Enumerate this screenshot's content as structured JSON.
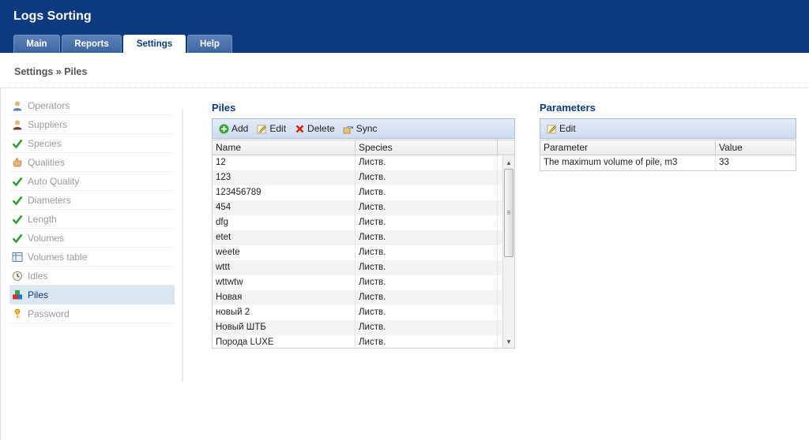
{
  "app": {
    "title": "Logs Sorting"
  },
  "tabs": [
    {
      "label": "Main"
    },
    {
      "label": "Reports"
    },
    {
      "label": "Settings",
      "active": true
    },
    {
      "label": "Help"
    }
  ],
  "breadcrumb": "Settings » Piles",
  "sidebar": {
    "items": [
      {
        "label": "Operators",
        "icon": "user-icon"
      },
      {
        "label": "Suppliers",
        "icon": "user-dark-icon"
      },
      {
        "label": "Species",
        "icon": "check-icon"
      },
      {
        "label": "Qualities",
        "icon": "hand-icon"
      },
      {
        "label": "Auto Quality",
        "icon": "check-icon"
      },
      {
        "label": "Diameters",
        "icon": "check-icon"
      },
      {
        "label": "Length",
        "icon": "check-icon"
      },
      {
        "label": "Volumes",
        "icon": "check-icon"
      },
      {
        "label": "Volumes table",
        "icon": "table-icon"
      },
      {
        "label": "Idles",
        "icon": "clock-icon"
      },
      {
        "label": "Piles",
        "icon": "boxes-icon",
        "active": true
      },
      {
        "label": "Password",
        "icon": "key-icon"
      }
    ]
  },
  "piles": {
    "title": "Piles",
    "toolbar": {
      "add": "Add",
      "edit": "Edit",
      "delete": "Delete",
      "sync": "Sync"
    },
    "columns": [
      "Name",
      "Species"
    ],
    "rows": [
      [
        "12",
        "Листв."
      ],
      [
        "123",
        "Листв."
      ],
      [
        "123456789",
        "Листв."
      ],
      [
        "454",
        "Листв."
      ],
      [
        "dfg",
        "Листв."
      ],
      [
        "etet",
        "Листв."
      ],
      [
        "weete",
        "Листв."
      ],
      [
        "wttt",
        "Листв."
      ],
      [
        "wttwtw",
        "Листв."
      ],
      [
        "Новая",
        "Листв."
      ],
      [
        "новый 2",
        "Листв."
      ],
      [
        "Новый ШТБ",
        "Листв."
      ],
      [
        "Порода LUXE",
        "Листв."
      ]
    ]
  },
  "parameters": {
    "title": "Parameters",
    "toolbar": {
      "edit": "Edit"
    },
    "columns": [
      "Parameter",
      "Value"
    ],
    "rows": [
      [
        "The maximum volume of pile, m3",
        "33"
      ]
    ]
  },
  "colors": {
    "header": "#0e3a7f",
    "accent": "#0e3a7f",
    "selected": "#dbe6f3"
  }
}
